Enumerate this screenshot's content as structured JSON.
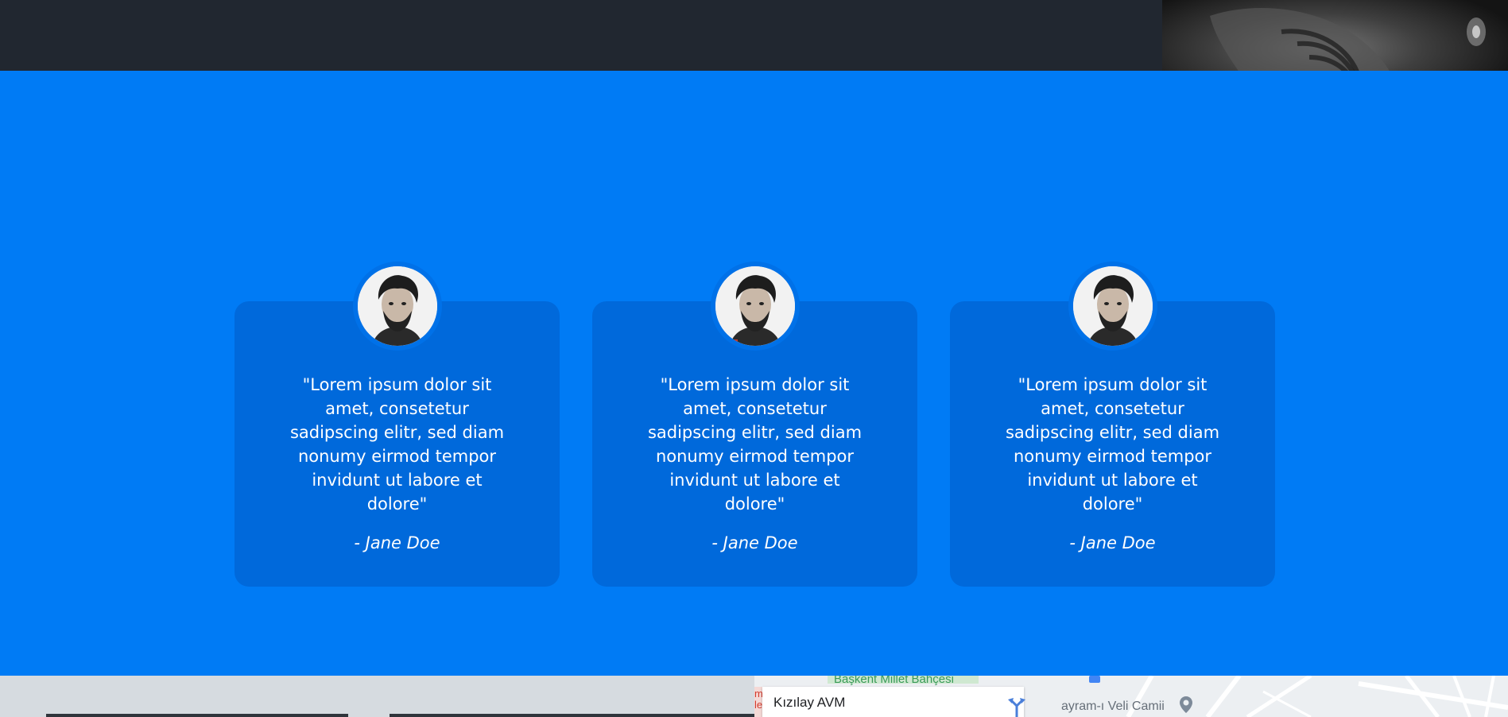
{
  "testimonials": [
    {
      "quote": "\"Lorem ipsum dolor sit amet, consetetur sadipscing elitr, sed diam nonumy eirmod tempor invidunt ut labore et dolore\"",
      "author": "- Jane Doe"
    },
    {
      "quote": "\"Lorem ipsum dolor sit amet, consetetur sadipscing elitr, sed diam nonumy eirmod tempor invidunt ut labore et dolore\"",
      "author": "- Jane Doe"
    },
    {
      "quote": "\"Lorem ipsum dolor sit amet, consetetur sadipscing elitr, sed diam nonumy eirmod tempor invidunt ut labore et dolore\"",
      "author": "- Jane Doe"
    }
  ],
  "map": {
    "place_name": "Kızılay AVM",
    "park_label": "Başkent Millet Bahçesi",
    "mosque_label": "ayram-ı Veli Camii",
    "edge_text": "m\nle"
  },
  "colors": {
    "dark_band": "#212730",
    "brand_blue": "#007bf5",
    "card_blue": "#0069db"
  },
  "icons": {
    "directions": "directions-icon",
    "map_pin": "map-pin-icon"
  }
}
